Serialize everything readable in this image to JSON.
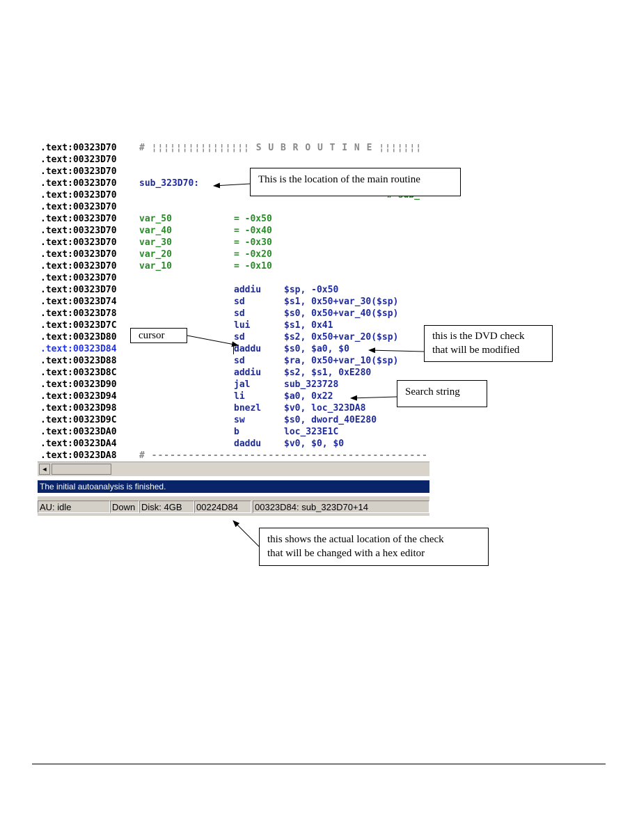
{
  "disassembly": {
    "lines": [
      {
        "addr": ".text:00323D70",
        "glyphs": "# ¦¦¦¦¦¦¦¦¦¦¦¦¦¦¦¦ S U B R O U T I N E ¦¦¦¦¦¦¦"
      },
      {
        "addr": ".text:00323D70"
      },
      {
        "addr": ".text:00323D70"
      },
      {
        "addr": ".text:00323D70",
        "label": "sub_323D70:"
      },
      {
        "addr": ".text:00323D70",
        "trail": "# sub_"
      },
      {
        "addr": ".text:00323D70"
      },
      {
        "addr": ".text:00323D70",
        "var": "var_50",
        "eq": "= -0x50"
      },
      {
        "addr": ".text:00323D70",
        "var": "var_40",
        "eq": "= -0x40"
      },
      {
        "addr": ".text:00323D70",
        "var": "var_30",
        "eq": "= -0x30"
      },
      {
        "addr": ".text:00323D70",
        "var": "var_20",
        "eq": "= -0x20"
      },
      {
        "addr": ".text:00323D70",
        "var": "var_10",
        "eq": "= -0x10"
      },
      {
        "addr": ".text:00323D70"
      },
      {
        "addr": ".text:00323D70",
        "mn": "addiu",
        "op": "$sp, -0x50"
      },
      {
        "addr": ".text:00323D74",
        "mn": "sd",
        "op": "$s1, 0x50+var_30($sp)"
      },
      {
        "addr": ".text:00323D78",
        "mn": "sd",
        "op": "$s0, 0x50+var_40($sp)"
      },
      {
        "addr": ".text:00323D7C",
        "mn": "lui",
        "op": "$s1, 0x41"
      },
      {
        "addr": ".text:00323D80",
        "mn": "sd",
        "op": "$s2, 0x50+var_20($sp)"
      },
      {
        "addr": ".text:00323D84",
        "mn": "daddu",
        "op": "$s0, $a0, $0",
        "current": true
      },
      {
        "addr": ".text:00323D88",
        "mn": "sd",
        "op": "$ra, 0x50+var_10($sp)"
      },
      {
        "addr": ".text:00323D8C",
        "mn": "addiu",
        "op": "$s2, $s1, 0xE280"
      },
      {
        "addr": ".text:00323D90",
        "mn": "jal",
        "op": "sub_323728"
      },
      {
        "addr": ".text:00323D94",
        "mn": "li",
        "op": "$a0, 0x22"
      },
      {
        "addr": ".text:00323D98",
        "mn": "bnezl",
        "op": "$v0, loc_323DA8"
      },
      {
        "addr": ".text:00323D9C",
        "mn": "sw",
        "op": "$s0, dword_40E280"
      },
      {
        "addr": ".text:00323DA0",
        "mn": "b",
        "op": "loc_323E1C"
      },
      {
        "addr": ".text:00323DA4",
        "mn": "daddu",
        "op": "$v0, $0, $0"
      },
      {
        "addr": ".text:00323DA8",
        "glyphs": "# ---------------------------------------------"
      }
    ]
  },
  "scrollbar": {
    "left_arrow": "◄"
  },
  "output_message": "The initial autoanalysis is finished.",
  "status": {
    "au": "AU: idle",
    "direction": "Down",
    "disk": "Disk: 4GB",
    "file_offset": "00224D84",
    "location": "00323D84: sub_323D70+14"
  },
  "callouts": {
    "main_routine": "This is the location of the main routine",
    "cursor": "cursor",
    "dvd_check_1": "this is the DVD check",
    "dvd_check_2": "that will be modified",
    "search_string": "Search string",
    "actual_location_1": "this shows the actual location of the check",
    "actual_location_2": "that will be changed with a hex editor"
  },
  "colors": {
    "address": "#000000",
    "current_address": "#2233ee",
    "label": "#2a8a2a",
    "instruction": "#1f2b9c",
    "output_bar": "#0a246a",
    "status_bar": "#d4d0c8"
  }
}
